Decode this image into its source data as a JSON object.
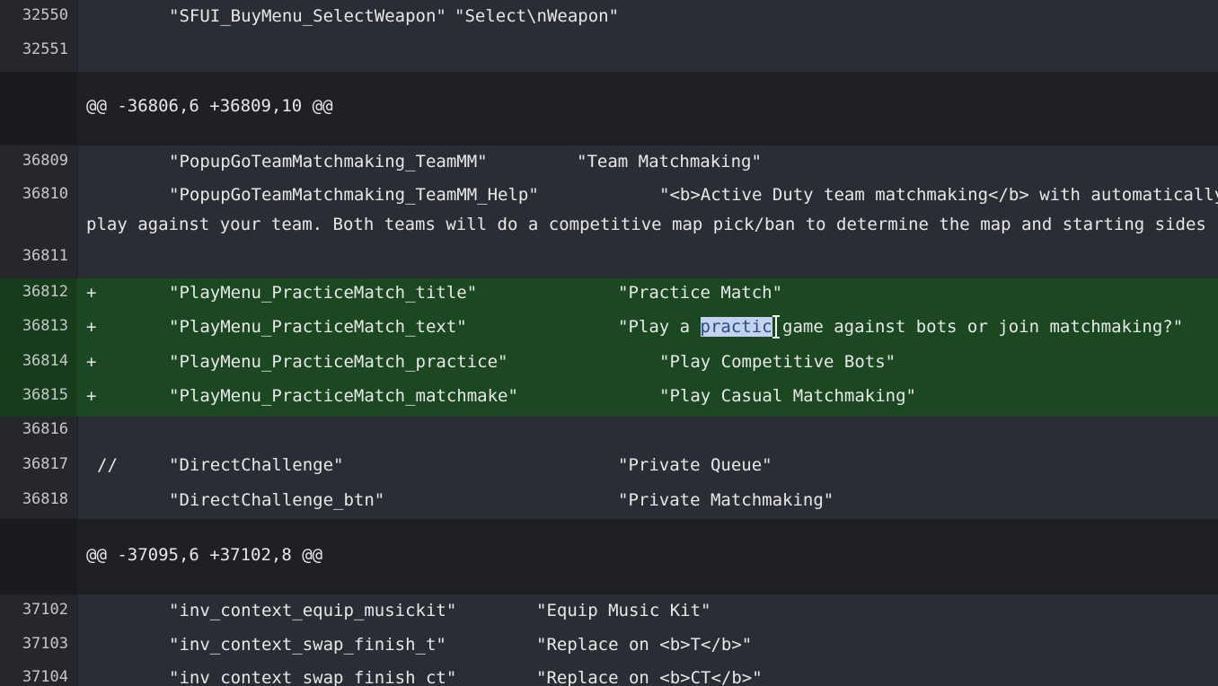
{
  "rows": {
    "r32550": {
      "num": "32550",
      "key": "\"SFUI_BuyMenu_SelectWeapon\"",
      "value": "\"Select\\nWeapon\""
    },
    "r32551": {
      "num": "32551"
    },
    "hunk1": {
      "text": "@@ -36806,6 +36809,10 @@"
    },
    "r36809": {
      "num": "36809",
      "key": "\"PopupGoTeamMatchmaking_TeamMM\"",
      "value": "\"Team Matchmaking\""
    },
    "r36810": {
      "num": "36810",
      "key": "\"PopupGoTeamMatchmaking_TeamMM_Help\"",
      "value": "\"<b>Active Duty team matchmaking</b> with automatically",
      "wrap": "play against your team. Both teams will do a competitive map pick/ban to determine the map and starting sides f"
    },
    "r36811": {
      "num": "36811"
    },
    "r36812": {
      "num": "36812",
      "marker": "+",
      "key": "\"PlayMenu_PracticeMatch_title\"",
      "value": "\"Practice Match\""
    },
    "r36813": {
      "num": "36813",
      "marker": "+",
      "key": "\"PlayMenu_PracticeMatch_text\"",
      "value_pre": "\"Play a ",
      "value_sel": "practic",
      "value_post": " game against bots or join matchmaking?\""
    },
    "r36814": {
      "num": "36814",
      "marker": "+",
      "key": "\"PlayMenu_PracticeMatch_practice\"",
      "value": "\"Play Competitive Bots\""
    },
    "r36815": {
      "num": "36815",
      "marker": "+",
      "key": "\"PlayMenu_PracticeMatch_matchmake\"",
      "value": "\"Play Casual Matchmaking\""
    },
    "r36816": {
      "num": "36816"
    },
    "r36817": {
      "num": "36817",
      "marker": "//",
      "key": "\"DirectChallenge\"",
      "value": "\"Private Queue\""
    },
    "r36818": {
      "num": "36818",
      "key": "\"DirectChallenge_btn\"",
      "value": "\"Private Matchmaking\""
    },
    "hunk2": {
      "text": "@@ -37095,6 +37102,8 @@"
    },
    "r37102": {
      "num": "37102",
      "key": "\"inv_context_equip_musickit\"",
      "value": "\"Equip Music Kit\""
    },
    "r37103": {
      "num": "37103",
      "key": "\"inv_context_swap_finish_t\"",
      "value": "\"Replace on <b>T</b>\""
    },
    "r37104": {
      "num": "37104",
      "key": "\"inv_context_swap_finish_ct\"",
      "value": "\"Replace on <b>CT</b>\""
    }
  },
  "colors": {
    "added_background": "#1b4721",
    "hunk_background": "#1e2025",
    "context_background": "#2b2d34",
    "selection": "#c2d2f0"
  }
}
